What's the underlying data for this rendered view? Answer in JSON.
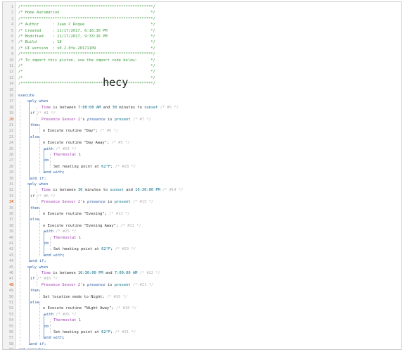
{
  "image_text": "hecy",
  "lines": [
    {
      "n": "1",
      "parts": [
        {
          "t": "/**********************************************************/",
          "c": "c"
        }
      ]
    },
    {
      "n": "2",
      "parts": [
        {
          "t": "/* Home Automation                                        */",
          "c": "c"
        }
      ]
    },
    {
      "n": "3",
      "parts": [
        {
          "t": "/**********************************************************/",
          "c": "c"
        }
      ]
    },
    {
      "n": "4",
      "parts": [
        {
          "t": "/* Author      : Juan C Roque                             */",
          "c": "c"
        }
      ]
    },
    {
      "n": "5",
      "parts": [
        {
          "t": "/* Created     : 11/17/2017, 6:16:30 PM                   */",
          "c": "c"
        }
      ]
    },
    {
      "n": "6",
      "parts": [
        {
          "t": "/* Modified    : 11/17/2017, 9:33:16 PM                   */",
          "c": "c"
        }
      ]
    },
    {
      "n": "7",
      "parts": [
        {
          "t": "/* Build       : 18                                       */",
          "c": "c"
        }
      ]
    },
    {
      "n": "8",
      "parts": [
        {
          "t": "/* UI version  : v0.2.0fe.20171109                        */",
          "c": "c"
        }
      ]
    },
    {
      "n": "9",
      "parts": [
        {
          "t": "/**********************************************************/",
          "c": "c"
        }
      ]
    },
    {
      "n": "10",
      "parts": [
        {
          "t": "/* To import this piston, use the import code below:      */",
          "c": "c"
        }
      ]
    },
    {
      "n": "11",
      "parts": [
        {
          "t": "/*                                                        */",
          "c": "c"
        }
      ]
    },
    {
      "n": "12",
      "parts": [
        {
          "t": "/*                                                        */",
          "c": "c"
        }
      ]
    },
    {
      "n": "13",
      "parts": [
        {
          "t": "/*                                                        */",
          "c": "c"
        }
      ]
    },
    {
      "n": "14",
      "parts": [
        {
          "t": "/**********************************************************/",
          "c": "c"
        }
      ]
    },
    {
      "n": "15",
      "parts": []
    },
    {
      "n": "16",
      "parts": [
        {
          "t": "execute",
          "c": "k"
        }
      ]
    },
    {
      "n": "17",
      "parts": [
        {
          "t": "only when",
          "c": "k"
        }
      ]
    },
    {
      "n": "18",
      "parts": [
        {
          "t": "Time",
          "c": "dev"
        },
        {
          "t": " is between ",
          "c": "t"
        },
        {
          "t": "7:00:00 AM",
          "c": "val"
        },
        {
          "t": " and ",
          "c": "t"
        },
        {
          "t": "30",
          "c": "val"
        },
        {
          "t": " minutes",
          "c": "t"
        },
        {
          "t": " to ",
          "c": "t"
        },
        {
          "t": "sunset",
          "c": "val"
        },
        {
          "t": " /* #5 */",
          "c": "n"
        }
      ]
    },
    {
      "n": "19",
      "parts": [
        {
          "t": "if",
          "c": "k"
        },
        {
          "t": " /* #1 */",
          "c": "n"
        }
      ]
    },
    {
      "n": "20",
      "w": true,
      "parts": [
        {
          "t": "Presence Sensor 2",
          "c": "dev"
        },
        {
          "t": "'s ",
          "c": "t"
        },
        {
          "t": "presence",
          "c": "o"
        },
        {
          "t": " is ",
          "c": "t"
        },
        {
          "t": "present",
          "c": "val"
        },
        {
          "t": " /* #7 */",
          "c": "n"
        }
      ]
    },
    {
      "n": "21",
      "parts": [
        {
          "t": "then",
          "c": "k"
        }
      ]
    },
    {
      "n": "22",
      "parts": [
        {
          "t": "⊙",
          "c": "ico"
        },
        {
          "t": " Execute routine \"Day\";",
          "c": "t"
        },
        {
          "t": " /* #6 */",
          "c": "n"
        }
      ]
    },
    {
      "n": "23",
      "parts": [
        {
          "t": "else",
          "c": "k"
        }
      ]
    },
    {
      "n": "24",
      "parts": [
        {
          "t": "⊙",
          "c": "ico"
        },
        {
          "t": " Execute routine \"Day Away\";",
          "c": "t"
        },
        {
          "t": " /* #5 */",
          "c": "n"
        }
      ]
    },
    {
      "n": "25",
      "parts": [
        {
          "t": "with",
          "c": "k"
        },
        {
          "t": " /* #23 */",
          "c": "n"
        }
      ]
    },
    {
      "n": "26",
      "parts": [
        {
          "t": "Thermostat 1",
          "c": "dev"
        }
      ]
    },
    {
      "n": "27",
      "parts": [
        {
          "t": "do",
          "c": "k"
        }
      ]
    },
    {
      "n": "28",
      "parts": [
        {
          "t": "Set heating point at ",
          "c": "t"
        },
        {
          "t": "62°F",
          "c": "val"
        },
        {
          "t": ";",
          "c": "t"
        },
        {
          "t": " /* #28 */",
          "c": "n"
        }
      ]
    },
    {
      "n": "29",
      "parts": [
        {
          "t": "end with;",
          "c": "k"
        }
      ]
    },
    {
      "n": "30",
      "parts": [
        {
          "t": "end if;",
          "c": "k"
        }
      ]
    },
    {
      "n": "31",
      "parts": [
        {
          "t": "only when",
          "c": "k"
        }
      ]
    },
    {
      "n": "32",
      "parts": [
        {
          "t": "Time",
          "c": "dev"
        },
        {
          "t": " is between ",
          "c": "t"
        },
        {
          "t": "30",
          "c": "val"
        },
        {
          "t": " minutes",
          "c": "t"
        },
        {
          "t": " to ",
          "c": "t"
        },
        {
          "t": "sunset",
          "c": "val"
        },
        {
          "t": " and ",
          "c": "t"
        },
        {
          "t": "10:30:00 PM",
          "c": "val"
        },
        {
          "t": " /* #14 */",
          "c": "n"
        }
      ]
    },
    {
      "n": "33",
      "parts": [
        {
          "t": "if",
          "c": "k"
        },
        {
          "t": " /* #6 */",
          "c": "n"
        }
      ]
    },
    {
      "n": "34",
      "w": true,
      "parts": [
        {
          "t": "Presence Sensor 2",
          "c": "dev"
        },
        {
          "t": "'s ",
          "c": "t"
        },
        {
          "t": "presence",
          "c": "o"
        },
        {
          "t": " is ",
          "c": "t"
        },
        {
          "t": "present",
          "c": "val"
        },
        {
          "t": " /* #15 */",
          "c": "n"
        }
      ]
    },
    {
      "n": "35",
      "parts": [
        {
          "t": "then",
          "c": "k"
        }
      ]
    },
    {
      "n": "36",
      "parts": [
        {
          "t": "⊙",
          "c": "ico"
        },
        {
          "t": " Execute routine \"Evening\";",
          "c": "t"
        },
        {
          "t": " /* #13 */",
          "c": "n"
        }
      ]
    },
    {
      "n": "37",
      "parts": [
        {
          "t": "else",
          "c": "k"
        }
      ]
    },
    {
      "n": "38",
      "parts": [
        {
          "t": "⊙",
          "c": "ico"
        },
        {
          "t": " Execute routine \"Evening Away\";",
          "c": "t"
        },
        {
          "t": " /* #11 */",
          "c": "n"
        }
      ]
    },
    {
      "n": "39",
      "parts": [
        {
          "t": "with",
          "c": "k"
        },
        {
          "t": " /* #25 */",
          "c": "n"
        }
      ]
    },
    {
      "n": "40",
      "parts": [
        {
          "t": "Thermostat 1",
          "c": "dev"
        }
      ]
    },
    {
      "n": "41",
      "parts": [
        {
          "t": "do",
          "c": "k"
        }
      ]
    },
    {
      "n": "42",
      "parts": [
        {
          "t": "Set heating point at ",
          "c": "t"
        },
        {
          "t": "62°F",
          "c": "val"
        },
        {
          "t": ";",
          "c": "t"
        },
        {
          "t": " /* #29 */",
          "c": "n"
        }
      ]
    },
    {
      "n": "43",
      "parts": [
        {
          "t": "end with;",
          "c": "k"
        }
      ]
    },
    {
      "n": "44",
      "parts": [
        {
          "t": "end if;",
          "c": "k"
        }
      ]
    },
    {
      "n": "45",
      "parts": [
        {
          "t": "only when",
          "c": "k"
        }
      ]
    },
    {
      "n": "46",
      "parts": [
        {
          "t": "Time",
          "c": "dev"
        },
        {
          "t": " is between ",
          "c": "t"
        },
        {
          "t": "10:30:00 PM",
          "c": "val"
        },
        {
          "t": " and ",
          "c": "t"
        },
        {
          "t": "7:00:00 AM",
          "c": "val"
        },
        {
          "t": " /* #22 */",
          "c": "n"
        }
      ]
    },
    {
      "n": "47",
      "parts": [
        {
          "t": "if",
          "c": "k"
        },
        {
          "t": " /* #16 */",
          "c": "n"
        }
      ]
    },
    {
      "n": "48",
      "w": true,
      "parts": [
        {
          "t": "Presence Sensor 2",
          "c": "dev"
        },
        {
          "t": "'s ",
          "c": "t"
        },
        {
          "t": "presence",
          "c": "o"
        },
        {
          "t": " is ",
          "c": "t"
        },
        {
          "t": "present",
          "c": "val"
        },
        {
          "t": " /* #21 */",
          "c": "n"
        }
      ]
    },
    {
      "n": "49",
      "parts": [
        {
          "t": "then",
          "c": "k"
        }
      ]
    },
    {
      "n": "50",
      "parts": [
        {
          "t": "Set location mode to Night;",
          "c": "t"
        },
        {
          "t": " /* #20 */",
          "c": "n"
        }
      ]
    },
    {
      "n": "51",
      "parts": [
        {
          "t": "else",
          "c": "k"
        }
      ]
    },
    {
      "n": "52",
      "parts": [
        {
          "t": "⊙",
          "c": "ico"
        },
        {
          "t": " Execute routine \"Night Away\";",
          "c": "t"
        },
        {
          "t": " /* #18 */",
          "c": "n"
        }
      ]
    },
    {
      "n": "53",
      "parts": [
        {
          "t": "with",
          "c": "k"
        },
        {
          "t": " /* #26 */",
          "c": "n"
        }
      ]
    },
    {
      "n": "54",
      "parts": [
        {
          "t": "Thermostat 1",
          "c": "dev"
        }
      ]
    },
    {
      "n": "55",
      "parts": [
        {
          "t": "do",
          "c": "k"
        }
      ]
    },
    {
      "n": "56",
      "parts": [
        {
          "t": "Set heating point at ",
          "c": "t"
        },
        {
          "t": "62°F",
          "c": "val"
        },
        {
          "t": ";",
          "c": "t"
        },
        {
          "t": " /* #31 */",
          "c": "n"
        }
      ]
    },
    {
      "n": "57",
      "parts": [
        {
          "t": "end with;",
          "c": "k"
        }
      ]
    },
    {
      "n": "58",
      "parts": [
        {
          "t": "end if;",
          "c": "k"
        }
      ]
    },
    {
      "n": "59",
      "parts": [
        {
          "t": "end execute;",
          "c": "k"
        }
      ]
    }
  ]
}
